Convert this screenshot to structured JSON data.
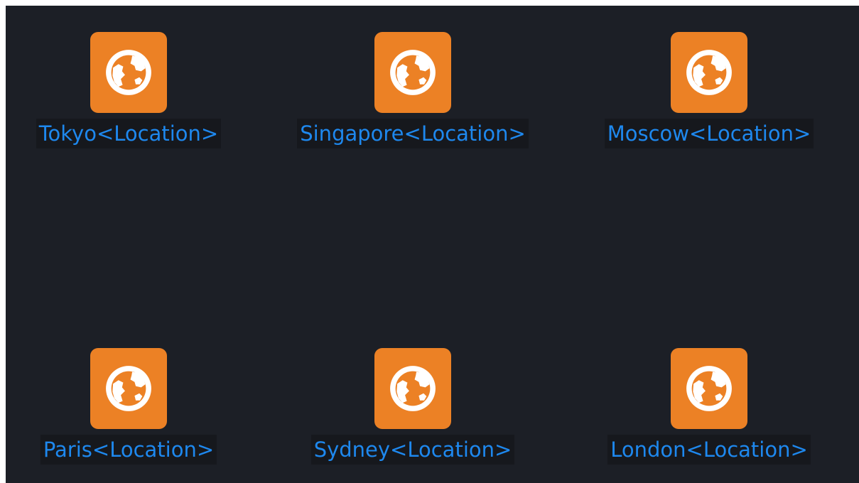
{
  "colors": {
    "tile": "#ec8125",
    "label": "#1e88ee",
    "globe": "#ffffff"
  },
  "desktop": {
    "items": [
      {
        "label": "Tokyo<Location>",
        "icon": "globe-icon"
      },
      {
        "label": "Singapore<Location>",
        "icon": "globe-icon"
      },
      {
        "label": "Moscow<Location>",
        "icon": "globe-icon"
      },
      {
        "label": "Paris<Location>",
        "icon": "globe-icon"
      },
      {
        "label": "Sydney<Location>",
        "icon": "globe-icon"
      },
      {
        "label": "London<Location>",
        "icon": "globe-icon"
      }
    ]
  }
}
